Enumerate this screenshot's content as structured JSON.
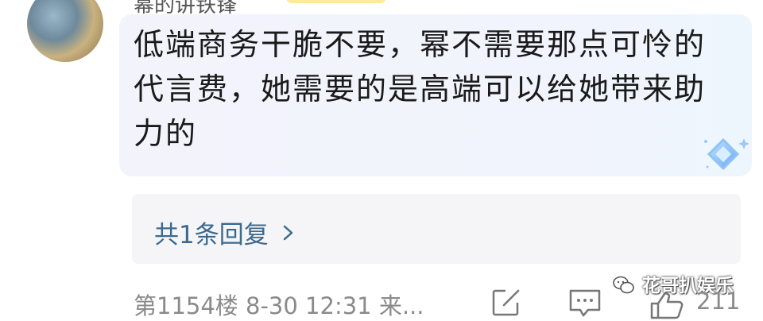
{
  "comment": {
    "username": "幂的讲铁锋",
    "text": "低端商务干脆不要，幂不需要那点可怜的代言费，她需要的是高端可以给她带来助力的"
  },
  "replies": {
    "link_label": "共1条回复"
  },
  "meta": {
    "floor_time": "第1154楼 8-30 12:31 来...",
    "like_count": "211"
  },
  "watermark": {
    "text": "花哥扒娱乐"
  },
  "icons": {
    "edit": "edit-icon",
    "comment": "comment-icon",
    "like": "thumbs-up-icon",
    "wechat": "wechat-icon",
    "decoration": "diamond-badge-icon"
  },
  "colors": {
    "reply_link": "#3b6a8e",
    "meta_text": "#8a8a8a",
    "bubble_bg": "#f2f4fc"
  }
}
